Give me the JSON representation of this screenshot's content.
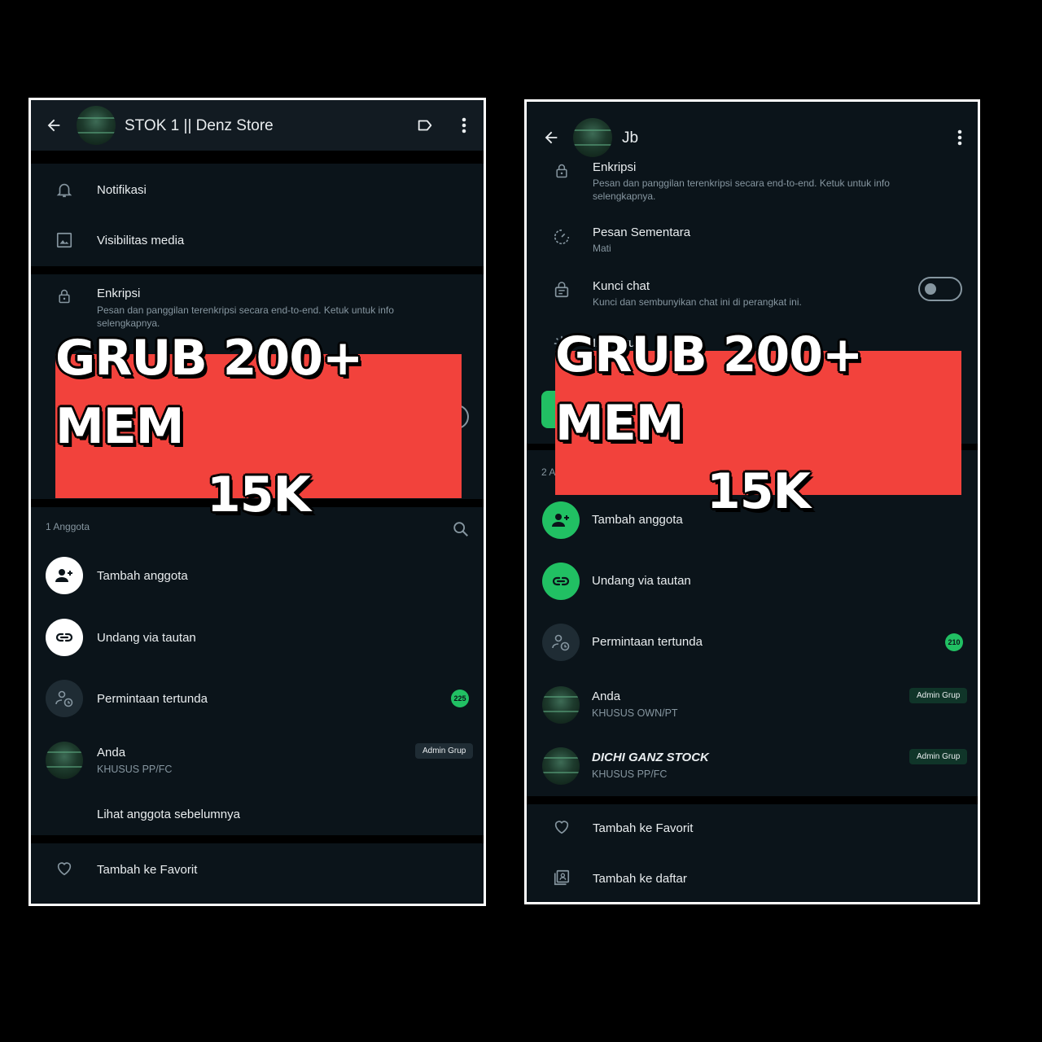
{
  "banner": {
    "line1": "GRUB 200+ MEM",
    "line2": "15K"
  },
  "left": {
    "title": "STOK 1 || Denz Store",
    "notifikasi": "Notifikasi",
    "visibilitas": "Visibilitas media",
    "enkripsi": "Enkripsi",
    "enkripsi_desc": "Pesan dan panggilan terenkripsi secara end-to-end. Ketuk untuk info selengkapnya.",
    "member_count": "1 Anggota",
    "tambah": "Tambah anggota",
    "undang": "Undang via tautan",
    "permintaan": "Permintaan tertunda",
    "permintaan_badge": "225",
    "anda": "Anda",
    "anda_status": "KHUSUS PP/FC",
    "admin_label": "Admin Grup",
    "lihat": "Lihat anggota sebelumnya",
    "favorit": "Tambah ke Favorit"
  },
  "right": {
    "title": "Jb",
    "enkripsi": "Enkripsi",
    "enkripsi_desc": "Pesan dan panggilan terenkripsi secara end-to-end. Ketuk untuk info selengkapnya.",
    "sementara": "Pesan Sementara",
    "sementara_val": "Mati",
    "kunci": "Kunci chat",
    "kunci_desc": "Kunci dan sembunyikan chat ini di perangkat ini.",
    "izin": "Izin Grup",
    "member_count_partial": "2 A",
    "tambah": "Tambah anggota",
    "undang": "Undang via tautan",
    "permintaan": "Permintaan tertunda",
    "permintaan_badge": "210",
    "anda": "Anda",
    "anda_status": "KHUSUS OWN/PT",
    "admin_label": "Admin Grup",
    "member2": "DICHI GANZ STOCK",
    "member2_status": "KHUSUS PP/FC",
    "favorit": "Tambah ke Favorit",
    "daftar": "Tambah ke daftar"
  },
  "colors": {
    "accent_green": "#21c063",
    "banner_red": "#f2423c",
    "background": "#0b141a"
  },
  "icons": [
    "back-arrow-icon",
    "label-icon",
    "more-vert-icon",
    "bell-icon",
    "image-icon",
    "lock-icon",
    "search-icon",
    "add-person-icon",
    "link-icon",
    "pending-person-icon",
    "heart-icon",
    "timer-icon",
    "chat-lock-icon",
    "gear-icon",
    "list-icon"
  ]
}
